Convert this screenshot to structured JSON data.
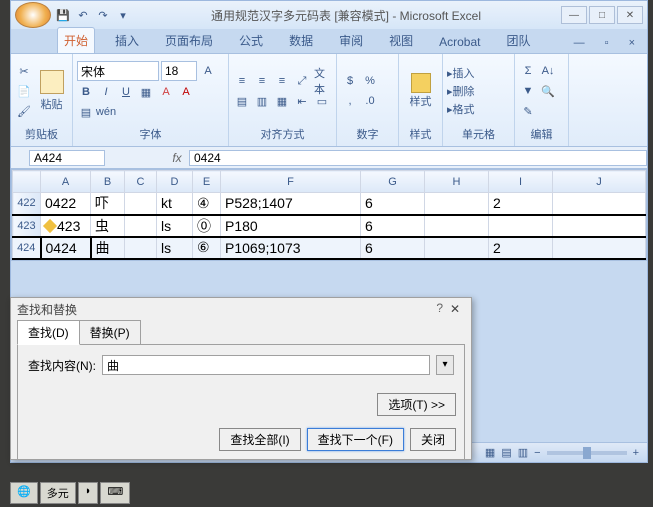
{
  "title": "通用规范汉字多元码表 [兼容模式] - Microsoft Excel",
  "qat": {
    "save": "💾",
    "undo": "↶",
    "redo": "↷"
  },
  "tabs": [
    "开始",
    "插入",
    "页面布局",
    "公式",
    "数据",
    "审阅",
    "视图",
    "Acrobat",
    "团队"
  ],
  "ribbon": {
    "clipboard": {
      "paste": "粘贴",
      "label": "剪贴板"
    },
    "font": {
      "name": "宋体",
      "size": "18",
      "label": "字体"
    },
    "align": {
      "label": "对齐方式",
      "wrap": "文本"
    },
    "number": {
      "label": "数字"
    },
    "style": {
      "btn": "样式",
      "label": "样式"
    },
    "cells": {
      "insert": "插入",
      "delete": "删除",
      "format": "格式",
      "label": "单元格"
    },
    "edit": {
      "label": "编辑"
    }
  },
  "formula": {
    "name": "A424",
    "fx": "fx",
    "value": "0424"
  },
  "columns": [
    "",
    "A",
    "B",
    "C",
    "D",
    "E",
    "F",
    "G",
    "H",
    "I",
    "J"
  ],
  "rows": [
    {
      "n": "422",
      "a": "0422",
      "b": "吓",
      "c": "",
      "d": "kt",
      "e": "④",
      "f": "P528;1407",
      "g": "6",
      "h": "",
      "i": "2",
      "j": "",
      "thick": false,
      "sel": false
    },
    {
      "n": "423",
      "a": "423",
      "b": "虫",
      "c": "",
      "d": "ls",
      "e": "⓪",
      "f": "P180",
      "g": "6",
      "h": "",
      "i": "",
      "j": "",
      "thick": true,
      "sel": false,
      "mark": true
    },
    {
      "n": "424",
      "a": "0424",
      "b": "曲",
      "c": "",
      "d": "ls",
      "e": "⑥",
      "f": "P1069;1073",
      "g": "6",
      "h": "",
      "i": "2",
      "j": "",
      "thick": true,
      "sel": true
    }
  ],
  "dialog": {
    "title": "查找和替换",
    "tab_find": "查找(D)",
    "tab_replace": "替换(P)",
    "find_label": "查找内容(N):",
    "find_value": "曲",
    "options": "选项(T) >>",
    "find_all": "查找全部(I)",
    "find_next": "查找下一个(F)",
    "close": "关闭"
  },
  "taskbar": {
    "globe": "🌐",
    "duoyuan": "多元",
    "moon": "◗",
    "keys": "⌨"
  },
  "zoom": {
    "minus": "−",
    "plus": "+"
  }
}
